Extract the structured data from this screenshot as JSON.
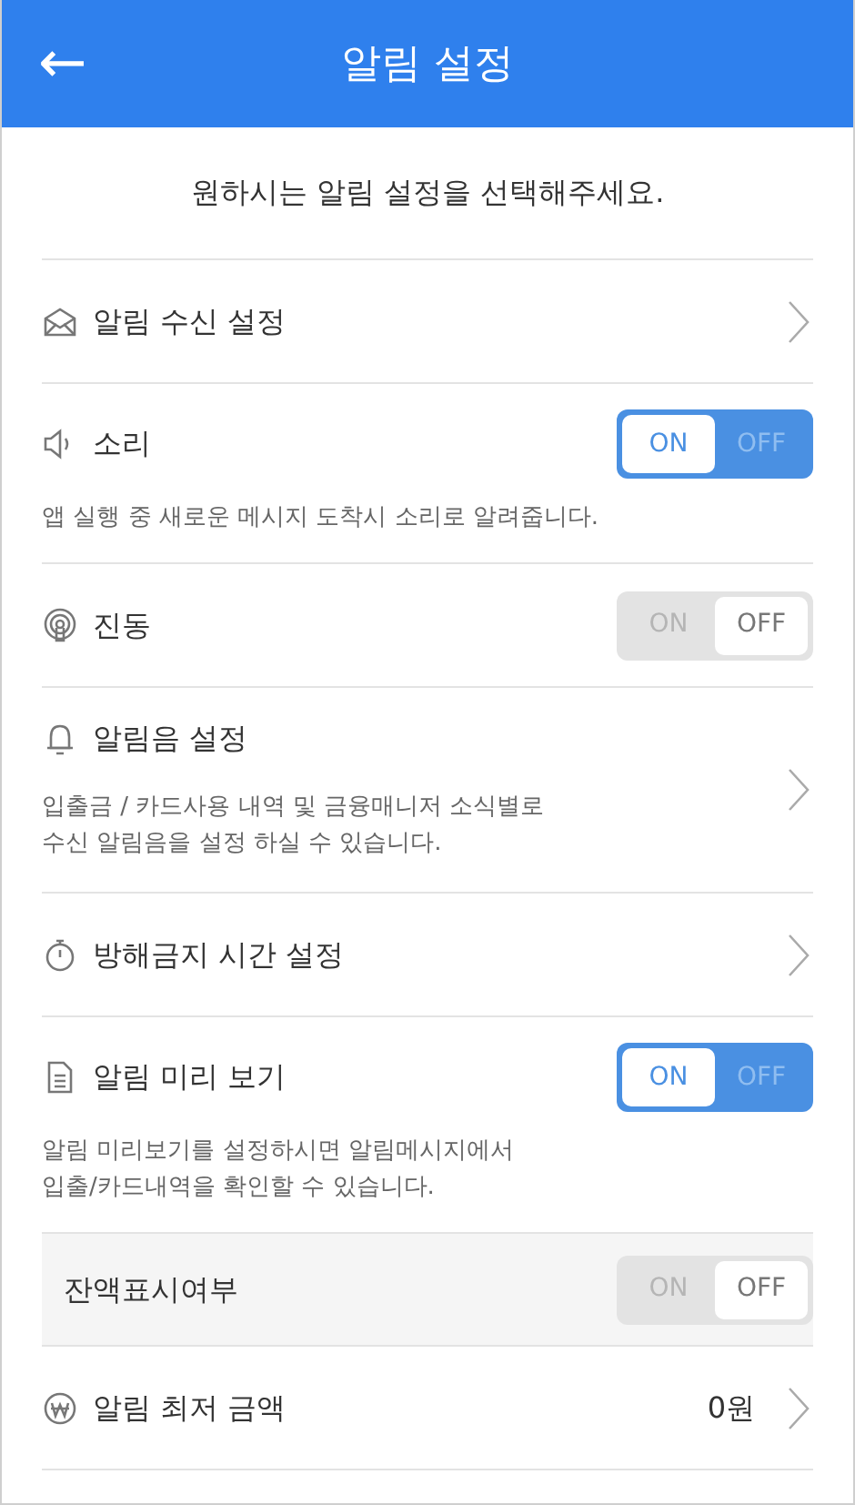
{
  "header": {
    "back_icon_label": "←",
    "title": "알림 설정"
  },
  "subtitle": "원하시는 알림 설정을 선택해주세요.",
  "rows": [
    {
      "kind": "link",
      "label": "알림 수신 설정"
    },
    {
      "kind": "toggle",
      "label": "소리",
      "on": true,
      "on_text": "ON",
      "off_text": "OFF",
      "description": "앱 실행 중 새로운 메시지 도착시 소리로 알려줍니다."
    },
    {
      "kind": "toggle",
      "label": "진동",
      "on": false,
      "on_text": "ON",
      "off_text": "OFF"
    },
    {
      "kind": "link",
      "label": "알림음 설정",
      "description": "입출금 / 카드사용 내역 및 금융매니저 소식별로\n수신 알림음을 설정 하실 수 있습니다."
    },
    {
      "kind": "link",
      "label": "방해금지 시간 설정"
    },
    {
      "kind": "toggle",
      "label": "알림 미리 보기",
      "on": true,
      "on_text": "ON",
      "off_text": "OFF",
      "description": "알림 미리보기를 설정하시면 알림메시지에서\n입출/카드내역을 확인할 수 있습니다."
    },
    {
      "kind": "subtoggle",
      "label": "잔액표시여부",
      "on": false,
      "on_text": "ON",
      "off_text": "OFF"
    },
    {
      "kind": "link",
      "label": "알림 최저 금액",
      "value": "0원"
    }
  ]
}
